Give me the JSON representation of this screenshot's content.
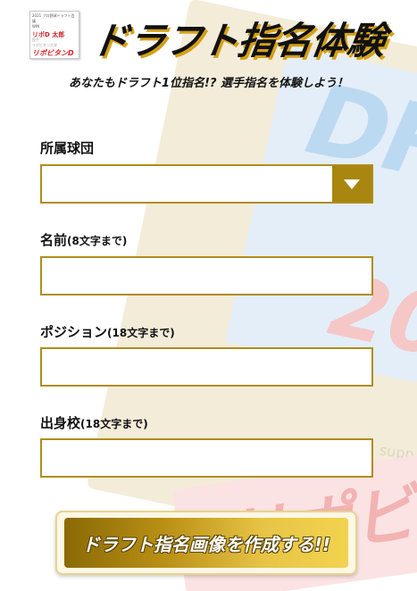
{
  "header": {
    "card": {
      "top_line": "2021 プロ野球ドラフト会議",
      "team_line": "WIN",
      "player_name": "リポD 太郎",
      "small_line_1": "投手",
      "small_line_2": "リポビタン大学",
      "brand": "リポビタンD"
    },
    "title": "ドラフト指名体験",
    "subtitle": "あなたもドラフト1位指名!? 選手指名を体験しよう！"
  },
  "background": {
    "support_text": "supp"
  },
  "form": {
    "team": {
      "label": "所属球団",
      "value": ""
    },
    "name": {
      "label": "名前",
      "hint": "(8文字まで)",
      "value": ""
    },
    "position": {
      "label": "ポジション",
      "hint": "(18文字まで)",
      "value": ""
    },
    "school": {
      "label": "出身校",
      "hint": "(18文字まで)",
      "value": ""
    }
  },
  "submit": {
    "label": "ドラフト指名画像を作成する!!"
  },
  "colors": {
    "accent": "#b08d1e",
    "select_arrow_bg": "#a8860f",
    "button_gradient_start": "#8a6a06",
    "button_gradient_end": "#f2d34f"
  }
}
